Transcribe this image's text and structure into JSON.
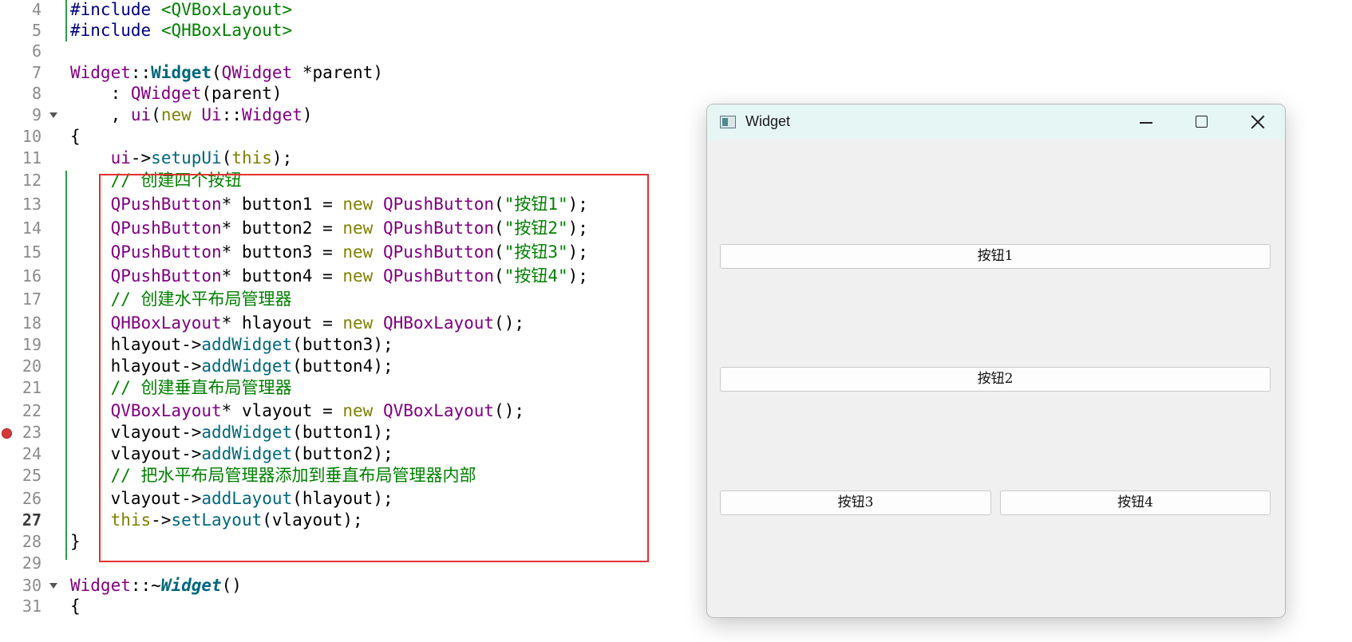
{
  "editor": {
    "lines": [
      {
        "num": "4"
      },
      {
        "num": "5"
      },
      {
        "num": "6"
      },
      {
        "num": "7"
      },
      {
        "num": "8"
      },
      {
        "num": "9"
      },
      {
        "num": "10"
      },
      {
        "num": "11"
      },
      {
        "num": "12"
      },
      {
        "num": "13"
      },
      {
        "num": "14"
      },
      {
        "num": "15"
      },
      {
        "num": "16"
      },
      {
        "num": "17"
      },
      {
        "num": "18"
      },
      {
        "num": "19"
      },
      {
        "num": "20"
      },
      {
        "num": "21"
      },
      {
        "num": "22"
      },
      {
        "num": "23"
      },
      {
        "num": "24"
      },
      {
        "num": "25"
      },
      {
        "num": "26"
      },
      {
        "num": "27"
      },
      {
        "num": "28"
      },
      {
        "num": "29"
      },
      {
        "num": "30"
      },
      {
        "num": "31"
      }
    ],
    "code": {
      "l4a": "#include",
      "l4b": "<QVBoxLayout>",
      "l5a": "#include",
      "l5b": "<QHBoxLayout>",
      "l7a": "Widget",
      "l7b": "::",
      "l7c": "Widget",
      "l7d": "(",
      "l7e": "QWidget",
      "l7f": " *parent)",
      "l8a": "    : ",
      "l8b": "QWidget",
      "l8c": "(parent)",
      "l9a": "    , ",
      "l9b": "ui",
      "l9c": "(",
      "l9d": "new",
      "l9e": " ",
      "l9f": "Ui",
      "l9g": "::",
      "l9h": "Widget",
      "l9i": ")",
      "l10": "{",
      "l11a": "    ",
      "l11b": "ui",
      "l11c": "->",
      "l11d": "setupUi",
      "l11e": "(",
      "l11f": "this",
      "l11g": ");",
      "l12": "    // 创建四个按钮",
      "l13a": "QPushButton",
      "l13b": "* button1 = ",
      "l13c": "new",
      "l13d": " ",
      "l13e": "QPushButton",
      "l13f": "(",
      "l13g": "\"按钮1\"",
      "l13h": ");",
      "l14a": "QPushButton",
      "l14b": "* button2 = ",
      "l14c": "new",
      "l14d": " ",
      "l14e": "QPushButton",
      "l14f": "(",
      "l14g": "\"按钮2\"",
      "l14h": ");",
      "l15a": "QPushButton",
      "l15b": "* button3 = ",
      "l15c": "new",
      "l15d": " ",
      "l15e": "QPushButton",
      "l15f": "(",
      "l15g": "\"按钮3\"",
      "l15h": ");",
      "l16a": "QPushButton",
      "l16b": "* button4 = ",
      "l16c": "new",
      "l16d": " ",
      "l16e": "QPushButton",
      "l16f": "(",
      "l16g": "\"按钮4\"",
      "l16h": ");",
      "l17": "    // 创建水平布局管理器",
      "l18a": "QHBoxLayout",
      "l18b": "* hlayout = ",
      "l18c": "new",
      "l18d": " ",
      "l18e": "QHBoxLayout",
      "l18f": "();",
      "l19a": "hlayout->",
      "l19b": "addWidget",
      "l19c": "(button3);",
      "l20a": "hlayout->",
      "l20b": "addWidget",
      "l20c": "(button4);",
      "l21": "    // 创建垂直布局管理器",
      "l22a": "QVBoxLayout",
      "l22b": "* vlayout = ",
      "l22c": "new",
      "l22d": " ",
      "l22e": "QVBoxLayout",
      "l22f": "();",
      "l23a": "vlayout->",
      "l23b": "addWidget",
      "l23c": "(button1);",
      "l24a": "vlayout->",
      "l24b": "addWidget",
      "l24c": "(button2);",
      "l25": "    // 把水平布局管理器添加到垂直布局管理器内部",
      "l26a": "vlayout->",
      "l26b": "addLayout",
      "l26c": "(hlayout);",
      "l27a": "this",
      "l27b": "->",
      "l27c": "setLayout",
      "l27d": "(vlayout);",
      "l28": "}",
      "l30a": "Widget",
      "l30b": "::~",
      "l30c": "Widget",
      "l30d": "()",
      "l31": "{"
    }
  },
  "window": {
    "title": "Widget",
    "buttons": {
      "b1": "按钮1",
      "b2": "按钮2",
      "b3": "按钮3",
      "b4": "按钮4"
    }
  },
  "colors": {
    "keyword": "#808000",
    "type": "#800080",
    "function": "#00677c",
    "string_comment": "#008000",
    "highlight_box": "#e53131",
    "window_titlebar": "#e6f6f4"
  }
}
